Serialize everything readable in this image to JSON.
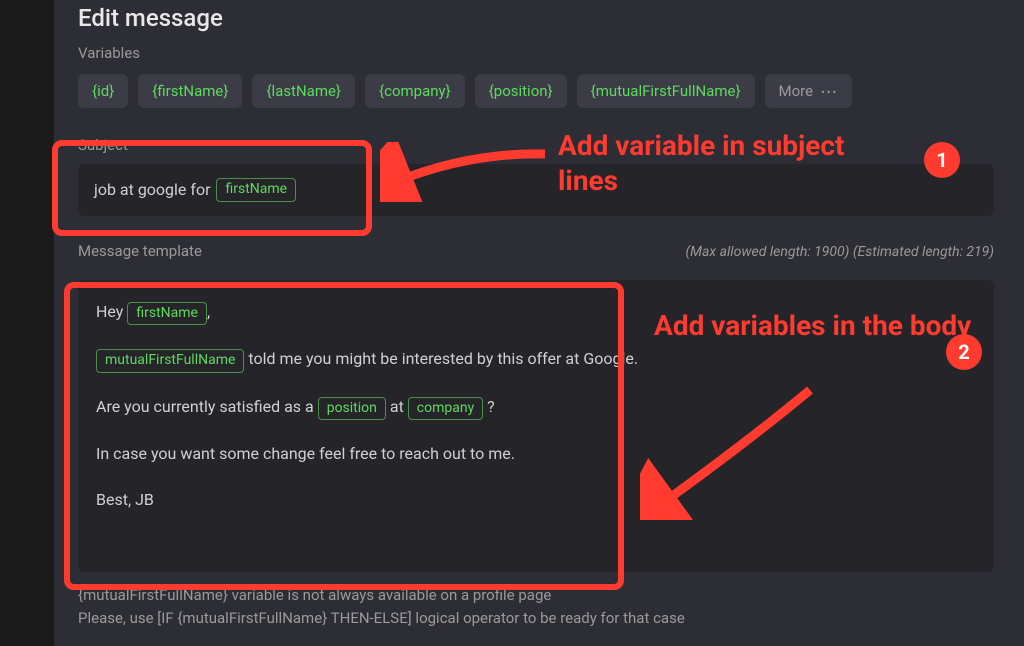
{
  "page": {
    "title": "Edit message"
  },
  "variables": {
    "label": "Variables",
    "chips": [
      "{id}",
      "{firstName}",
      "{lastName}",
      "{company}",
      "{position}",
      "{mutualFirstFullName}"
    ],
    "more_label": "More"
  },
  "subject": {
    "label": "Subject",
    "text_prefix": "job at google for ",
    "variable": "firstName"
  },
  "template": {
    "label": "Message template",
    "max_length_label": "(Max allowed length: 1900)",
    "estimated_length_label": "(Estimated length: 219)",
    "line1_prefix": "Hey ",
    "line1_var": "firstName",
    "line1_suffix": ",",
    "line2_var": "mutualFirstFullName",
    "line2_suffix": " told me you might be interested by this offer at Google.",
    "line3_prefix": "Are you currently satisfied as a ",
    "line3_var1": "position",
    "line3_mid": " at ",
    "line3_var2": "company",
    "line3_suffix": " ?",
    "line4": "In case you want some change feel free to reach out to me.",
    "line5": "Best, JB"
  },
  "footnote": {
    "line1": "{mutualFirstFullName} variable is not always available on a profile page",
    "line2": "Please, use [IF {mutualFirstFullName} THEN-ELSE] logical operator to be ready for that case"
  },
  "annotations": {
    "text1": "Add variable in subject lines",
    "badge1": "1",
    "text2": "Add variables in the body",
    "badge2": "2"
  },
  "colors": {
    "accent_green": "#5fd960",
    "annotation_red": "#ff3b30",
    "bg_panel": "#2d2d35",
    "bg_input": "#252529"
  }
}
